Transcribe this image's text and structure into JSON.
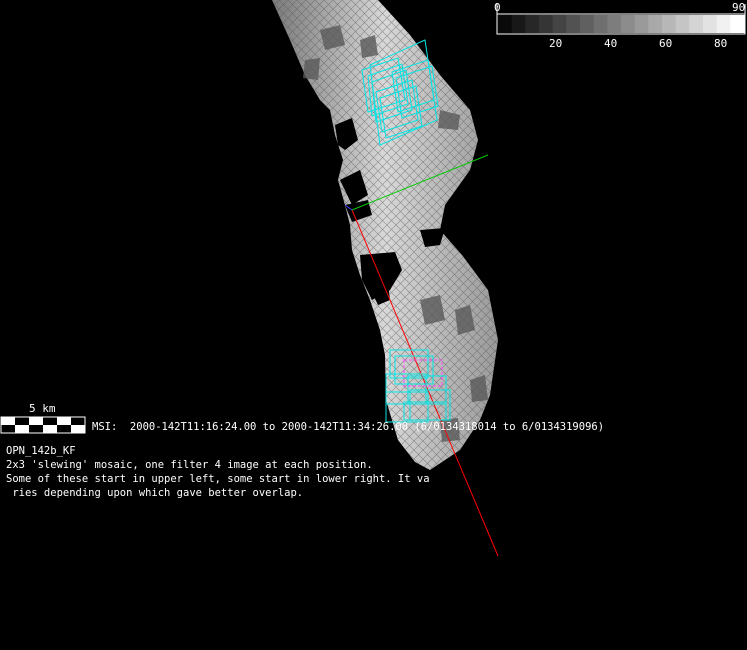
{
  "colorbar": {
    "min_label": "0",
    "max_label": "90",
    "ticks": [
      "20",
      "40",
      "60",
      "80"
    ]
  },
  "scale_bar": {
    "label": "5 km"
  },
  "observation": {
    "msi_line": "MSI:  2000-142T11:16:24.00 to 2000-142T11:34:26.00 (6/0134318014 to 6/0134319096)"
  },
  "notes": {
    "title": "OPN_142b_KF",
    "line1": "2x3 'slewing' mosaic, one filter 4 image at each position.",
    "line2": "Some of these start in upper left, some start in lower right. It va",
    "line3": " ries depending upon which gave better overlap."
  },
  "colors": {
    "background": "#000000",
    "footprint": "#00e5e5",
    "footprint_alt": "#ff40ff",
    "red_vector": "#ff0000",
    "green_vector": "#00cc00"
  }
}
